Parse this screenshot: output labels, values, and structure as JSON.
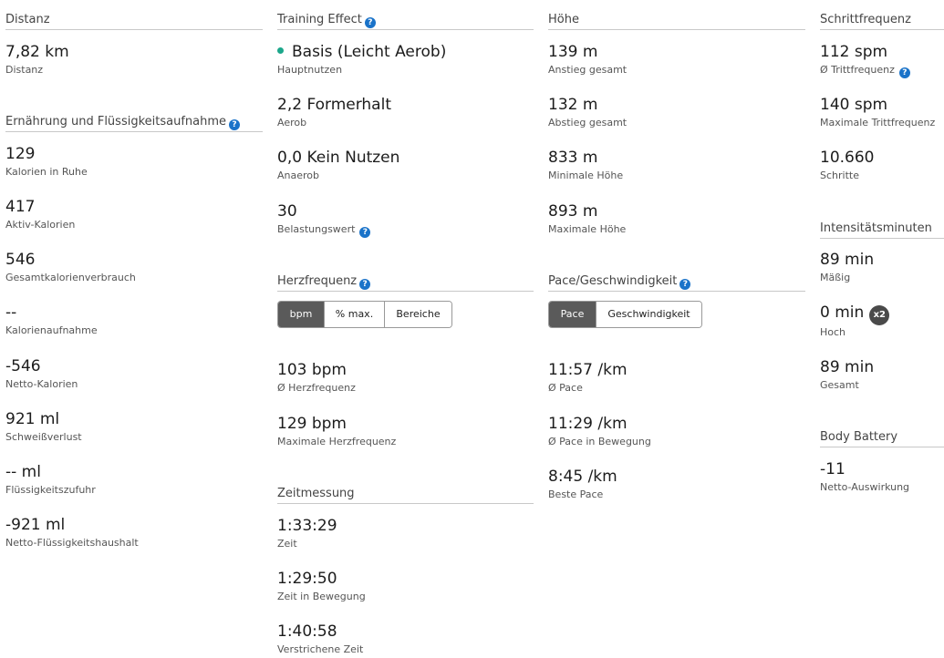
{
  "colors": {
    "help_icon": "#1a73c9",
    "aerob_dot": "#1ca78b",
    "toggle_active": "#5a5a5a"
  },
  "help_glyph": "?",
  "distanz": {
    "title": "Distanz",
    "value": "7,82 km",
    "label": "Distanz"
  },
  "ernaehrung": {
    "title": "Ernährung und Flüssigkeitsaufnahme",
    "stats": [
      {
        "value": "129",
        "label": "Kalorien in Ruhe"
      },
      {
        "value": "417",
        "label": "Aktiv-Kalorien"
      },
      {
        "value": "546",
        "label": "Gesamtkalorienverbrauch"
      },
      {
        "value": "--",
        "label": "Kalorienaufnahme"
      },
      {
        "value": "-546",
        "label": "Netto-Kalorien"
      },
      {
        "value": "921 ml",
        "label": "Schweißverlust"
      },
      {
        "value": "-- ml",
        "label": "Flüssigkeitszufuhr"
      },
      {
        "value": "-921 ml",
        "label": "Netto-Flüssigkeitshaushalt"
      }
    ]
  },
  "training_effect": {
    "title": "Training Effect",
    "primary": {
      "value": "Basis (Leicht Aerob)",
      "label": "Hauptnutzen"
    },
    "aerob": {
      "value": "2,2 Formerhalt",
      "label": "Aerob"
    },
    "anaerob": {
      "value": "0,0 Kein Nutzen",
      "label": "Anaerob"
    },
    "load": {
      "value": "30",
      "label": "Belastungswert"
    }
  },
  "herzfrequenz": {
    "title": "Herzfrequenz",
    "toggle": [
      "bpm",
      "% max.",
      "Bereiche"
    ],
    "active": "bpm",
    "avg": {
      "value": "103 bpm",
      "label": "Ø Herzfrequenz"
    },
    "max": {
      "value": "129 bpm",
      "label": "Maximale Herzfrequenz"
    }
  },
  "zeitmessung": {
    "title": "Zeitmessung",
    "stats": [
      {
        "value": "1:33:29",
        "label": "Zeit"
      },
      {
        "value": "1:29:50",
        "label": "Zeit in Bewegung"
      },
      {
        "value": "1:40:58",
        "label": "Verstrichene Zeit"
      }
    ]
  },
  "hoehe": {
    "title": "Höhe",
    "stats": [
      {
        "value": "139 m",
        "label": "Anstieg gesamt"
      },
      {
        "value": "132 m",
        "label": "Abstieg gesamt"
      },
      {
        "value": "833 m",
        "label": "Minimale Höhe"
      },
      {
        "value": "893 m",
        "label": "Maximale Höhe"
      }
    ]
  },
  "pace": {
    "title": "Pace/Geschwindigkeit",
    "toggle": [
      "Pace",
      "Geschwindigkeit"
    ],
    "active": "Pace",
    "stats": [
      {
        "value": "11:57 /km",
        "label": "Ø Pace"
      },
      {
        "value": "11:29 /km",
        "label": "Ø Pace in Bewegung"
      },
      {
        "value": "8:45 /km",
        "label": "Beste Pace"
      }
    ]
  },
  "schrittfrequenz": {
    "title": "Schrittfrequenz",
    "avg": {
      "value": "112 spm",
      "label": "Ø Trittfrequenz"
    },
    "max": {
      "value": "140 spm",
      "label": "Maximale Trittfrequenz"
    },
    "steps": {
      "value": "10.660",
      "label": "Schritte"
    }
  },
  "intensitaet": {
    "title": "Intensitätsminuten",
    "moderate": {
      "value": "89 min",
      "label": "Mäßig"
    },
    "high": {
      "value": "0 min",
      "label": "Hoch",
      "badge": "x2"
    },
    "total": {
      "value": "89 min",
      "label": "Gesamt"
    }
  },
  "body_battery": {
    "title": "Body Battery",
    "value": "-11",
    "label": "Netto-Auswirkung"
  }
}
